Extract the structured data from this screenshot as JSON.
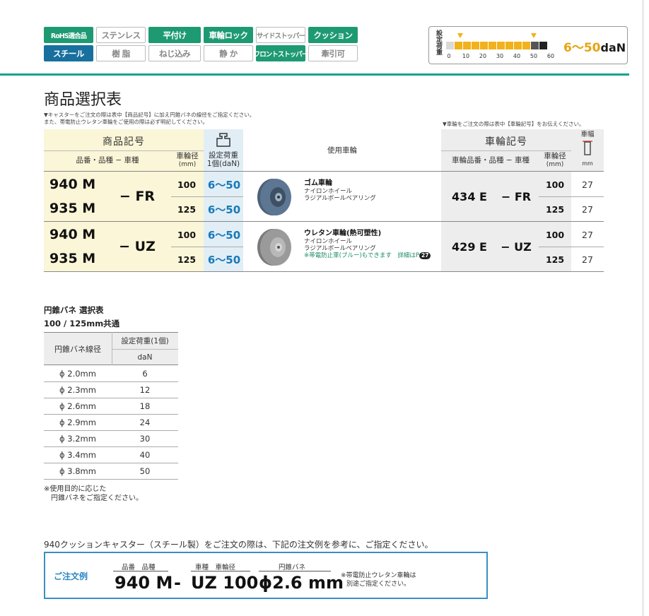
{
  "tags": [
    {
      "label": "RoHS適合品",
      "state": "on-green"
    },
    {
      "label": "ステンレス",
      "state": "off"
    },
    {
      "label": "平付け",
      "state": "on-green"
    },
    {
      "label": "車輪ロック",
      "state": "on-green"
    },
    {
      "label": "サイドストッパー",
      "state": "off"
    },
    {
      "label": "クッション",
      "state": "on-green"
    },
    {
      "label": "スチール",
      "state": "on-blue"
    },
    {
      "label": "樹 脂",
      "state": "off"
    },
    {
      "label": "ねじ込み",
      "state": "off"
    },
    {
      "label": "静 か",
      "state": "off"
    },
    {
      "label": "フロントストッパー",
      "state": "on-green"
    },
    {
      "label": "牽引可",
      "state": "off"
    }
  ],
  "gauge": {
    "label": "設定荷重",
    "ticks": [
      "0",
      "10",
      "20",
      "30",
      "40",
      "50",
      "60"
    ],
    "filled_from": 6,
    "filled_to": 50,
    "range": "6〜50",
    "unit": "daN"
  },
  "title": "商品選択表",
  "notes": {
    "left_1": "▼キャスターをご注文の際は表中【商品記号】に加え円錐バネの線径をご指定ください。",
    "left_2": "また、帯電防止ウレタン車輪をご使用の際は必ず明記してください。",
    "right": "▼車輪をご注文の際は表中【車輪記号】をお伝えください。"
  },
  "main_table": {
    "headers": {
      "product_code": "商品記号",
      "model_kind": "品番・品種 − 車種",
      "wheel_dia": "車輪径",
      "mm": "(mm)",
      "load_1": "設定荷重",
      "load_2": "1個(daN)",
      "wheel_used": "使用車輪",
      "wheel_code": "車輪記号",
      "wheel_model": "車輪品番・品種 − 車種",
      "wheel_width": "車幅",
      "mm_plain": "mm"
    },
    "groups": [
      {
        "models": [
          "940 M",
          "935 M"
        ],
        "type": "− FR",
        "rows": [
          {
            "dia": "100",
            "load": "6〜50",
            "width": "27"
          },
          {
            "dia": "125",
            "load": "6〜50",
            "width": "27"
          }
        ],
        "wheel_name": "ゴム車輪",
        "wheel_lines": [
          "ナイロンホイール",
          "ラジアルボールベアリング"
        ],
        "wheel_note": "",
        "wheel_code": "434 E",
        "wheel_type": "− FR"
      },
      {
        "models": [
          "940 M",
          "935 M"
        ],
        "type": "− UZ",
        "rows": [
          {
            "dia": "100",
            "load": "6〜50",
            "width": "27"
          },
          {
            "dia": "125",
            "load": "6〜50",
            "width": "27"
          }
        ],
        "wheel_name": "ウレタン車輪(熱可塑性)",
        "wheel_lines": [
          "ナイロンホイール",
          "ラジアルボールベアリング"
        ],
        "wheel_note": "※帯電防止車(ブルー)もできます　詳細はP",
        "wheel_page": "27",
        "wheel_code": "429 E",
        "wheel_type": "− UZ"
      }
    ]
  },
  "spring": {
    "title": "円錐バネ 選択表",
    "subtitle": "100 / 125mm共通",
    "col1": "円錐バネ線径",
    "col2_1": "設定荷重(1個)",
    "col2_2": "daN",
    "rows": [
      {
        "dia": "ϕ 2.0mm",
        "load": "6"
      },
      {
        "dia": "ϕ 2.3mm",
        "load": "12"
      },
      {
        "dia": "ϕ 2.6mm",
        "load": "18"
      },
      {
        "dia": "ϕ 2.9mm",
        "load": "24"
      },
      {
        "dia": "ϕ 3.2mm",
        "load": "30"
      },
      {
        "dia": "ϕ 3.4mm",
        "load": "40"
      },
      {
        "dia": "ϕ 3.8mm",
        "load": "50"
      }
    ],
    "note_1": "※使用目的に応じた",
    "note_2": "円錐バネをご指定ください。"
  },
  "order": {
    "intro": "940クッションキャスター（スチール製）をご注文の際は、下記の注文例を参考に、ご指定ください。",
    "label": "ご注文例",
    "cap_model": "品番　品種",
    "cap_type": "車種　車輪径",
    "cap_spring": "円錐バネ",
    "val_model": "940 M",
    "dash": "-",
    "val_type": "UZ 100",
    "val_spring": "ϕ2.6 mm",
    "note_1": "※帯電防止ウレタン車輪は",
    "note_2": "別途ご指定ください。"
  },
  "colors": {
    "accent_green": "#1e9a73",
    "accent_blue": "#17709e",
    "load_blue": "#1a79b8",
    "gauge_yellow": "#f2b21b"
  }
}
